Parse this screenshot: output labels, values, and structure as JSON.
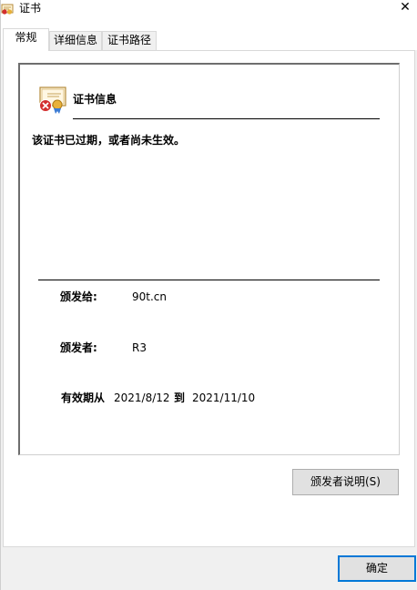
{
  "window": {
    "title": "证书",
    "close_glyph": "✕"
  },
  "tabs": [
    {
      "label": "常规",
      "active": true
    },
    {
      "label": "详细信息",
      "active": false
    },
    {
      "label": "证书路径",
      "active": false
    }
  ],
  "certificate": {
    "heading": "证书信息",
    "status": "该证书已过期，或者尚未生效。",
    "issued_to_label": "颁发给:",
    "issued_to_value": "90t.cn",
    "issued_by_label": "颁发者:",
    "issued_by_value": "R3",
    "valid_from_label": "有效期从",
    "valid_from_value": "2021/8/12",
    "valid_to_label": "到",
    "valid_to_value": "2021/11/10"
  },
  "buttons": {
    "issuer_statement": "颁发者说明(S)",
    "ok": "确定"
  },
  "icons": {
    "app": "certificate-icon",
    "cert": "certificate-error-icon",
    "close": "close-icon"
  },
  "colors": {
    "accent": "#0078d7",
    "error": "#d32f2f",
    "seal": "#e8b13a"
  }
}
